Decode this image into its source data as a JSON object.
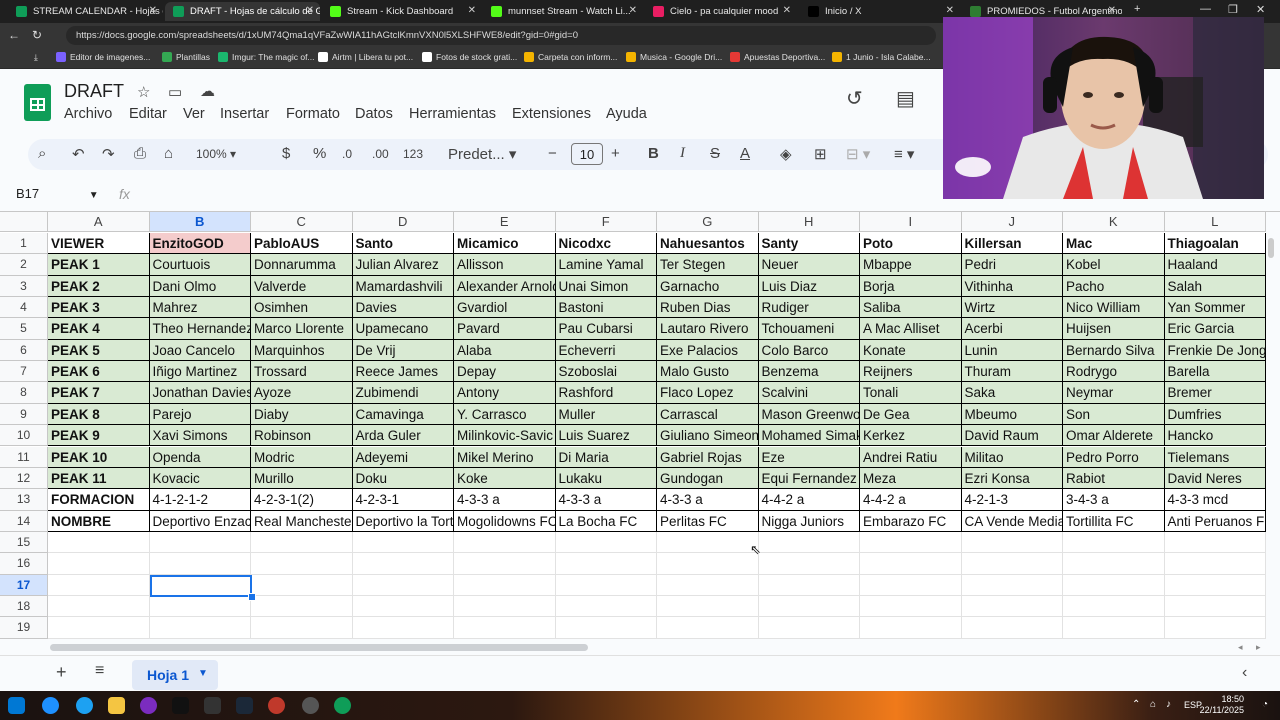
{
  "browser": {
    "tabs": [
      {
        "title": "STREAM CALENDAR - Hojas de c...",
        "color": "#0f9d58"
      },
      {
        "title": "DRAFT - Hojas de cálculo de Goo...",
        "color": "#0f9d58",
        "active": true
      },
      {
        "title": "Stream - Kick Dashboard",
        "color": "#53fc18"
      },
      {
        "title": "munnset Stream - Watch Li...",
        "color": "#53fc18"
      },
      {
        "title": "Cielo - pa cualquier mood",
        "color": "#e91e63"
      },
      {
        "title": "Inicio / X",
        "color": "#000000"
      },
      {
        "title": "PROMIEDOS - Futbol Argentino",
        "color": "#2e7d32"
      }
    ],
    "url": "https://docs.google.com/spreadsheets/d/1xUM74Qma1qVFaZwWIA11hAGtclKmnVXN0l5XLSHFWE8/edit?gid=0#gid=0",
    "bookmarks": [
      "Editor de imagenes...",
      "Plantillas",
      "Imgur: The magic of...",
      "Airtm | Libera tu pot...",
      "Fotos de stock grati...",
      "Carpeta con inform...",
      "Musica - Google Dri...",
      "Apuestas Deportiva...",
      "1 Junio - Isla Calabe..."
    ]
  },
  "sheets": {
    "title": "DRAFT",
    "menus": [
      "Archivo",
      "Editar",
      "Ver",
      "Insertar",
      "Formato",
      "Datos",
      "Herramientas",
      "Extensiones",
      "Ayuda"
    ],
    "toolbar": {
      "zoom": "100%",
      "currency": "$",
      "percent": "%",
      "dec_less": ".0",
      "dec_more": ".00",
      "number_format": "123",
      "font": "Predet...",
      "font_size": "10"
    },
    "name_box": "B17",
    "fx": "fx",
    "columns": [
      "A",
      "B",
      "C",
      "D",
      "E",
      "F",
      "G",
      "H",
      "I",
      "J",
      "K",
      "L"
    ],
    "selected_column": "B",
    "selected_row": "17",
    "rows": [
      [
        "VIEWER",
        "EnzitoGOD",
        "PabloAUS",
        "Santo",
        "Micamico",
        "Nicodxc",
        "Nahuesantos",
        "Santy",
        "Poto",
        "Killersan",
        "Mac",
        "Thiagoalan"
      ],
      [
        "PEAK 1",
        "Courtuois",
        "Donnarumma",
        "Julian Alvarez",
        "Allisson",
        "Lamine Yamal",
        "Ter Stegen",
        "Neuer",
        "Mbappe",
        "Pedri",
        "Kobel",
        "Haaland"
      ],
      [
        "PEAK 2",
        "Dani Olmo",
        "Valverde",
        "Mamardashvili",
        "Alexander Arnold",
        "Unai Simon",
        "Garnacho",
        "Luis Diaz",
        "Borja",
        "Vithinha",
        "Pacho",
        "Salah"
      ],
      [
        "PEAK 3",
        "Mahrez",
        "Osimhen",
        "Davies",
        "Gvardiol",
        "Bastoni",
        "Ruben Dias",
        "Rudiger",
        "Saliba",
        "Wirtz",
        "Nico William",
        "Yan Sommer"
      ],
      [
        "PEAK 4",
        "Theo Hernandez",
        "Marco Llorente",
        "Upamecano",
        "Pavard",
        "Pau Cubarsi",
        "Lautaro Rivero",
        "Tchouameni",
        "A Mac Alliset",
        "Acerbi",
        "Huijsen",
        "Eric Garcia"
      ],
      [
        "PEAK 5",
        "Joao Cancelo",
        "Marquinhos",
        "De Vrij",
        "Alaba",
        "Echeverri",
        "Exe Palacios",
        "Colo Barco",
        "Konate",
        "Lunin",
        "Bernardo Silva",
        "Frenkie De Jong"
      ],
      [
        "PEAK 6",
        "Iñigo Martinez",
        "Trossard",
        "Reece James",
        "Depay",
        "Szoboslai",
        "Malo Gusto",
        "Benzema",
        "Reijners",
        "Thuram",
        "Rodrygo",
        "Barella"
      ],
      [
        "PEAK 7",
        "Jonathan Davies",
        "Ayoze",
        "Zubimendi",
        "Antony",
        "Rashford",
        "Flaco Lopez",
        "Scalvini",
        "Tonali",
        "Saka",
        "Neymar",
        "Bremer"
      ],
      [
        "PEAK 8",
        "Parejo",
        "Diaby",
        "Camavinga",
        "Y. Carrasco",
        "Muller",
        "Carrascal",
        "Mason Greenwood",
        "De Gea",
        "Mbeumo",
        "Son",
        "Dumfries"
      ],
      [
        "PEAK 9",
        "Xavi Simons",
        "Robinson",
        "Arda Guler",
        "Milinkovic-Savic",
        "Luis Suarez",
        "Giuliano Simeone",
        "Mohamed Simakan",
        "Kerkez",
        "David Raum",
        "Omar Alderete",
        "Hancko"
      ],
      [
        "PEAK 10",
        "Openda",
        "Modric",
        "Adeyemi",
        "Mikel Merino",
        "Di Maria",
        "Gabriel Rojas",
        "Eze",
        "Andrei Ratiu",
        "Militao",
        "Pedro Porro",
        "Tielemans"
      ],
      [
        "PEAK 11",
        "Kovacic",
        "Murillo",
        "Doku",
        "Koke",
        "Lukaku",
        "Gundogan",
        "Equi Fernandez",
        "Meza",
        "Ezri Konsa",
        "Rabiot",
        "David Neres"
      ],
      [
        "FORMACION",
        "4-1-2-1-2",
        "4-2-3-1(2)",
        "4-2-3-1",
        "4-3-3 a",
        "4-3-3 a",
        "4-3-3 a",
        "4-4-2 a",
        "4-4-2 a",
        "4-2-1-3",
        "3-4-3 a",
        "4-3-3 mcd"
      ],
      [
        "NOMBRE",
        "Deportivo Enzacio",
        "Real Manchester",
        "Deportivo la Torta",
        "Mogolidowns FC",
        "La Bocha FC",
        "Perlitas FC",
        "Nigga Juniors",
        "Embarazo FC",
        "CA Vende Media",
        "Tortillita FC",
        "Anti Peruanos FC"
      ]
    ],
    "row_numbers": [
      "1",
      "2",
      "3",
      "4",
      "5",
      "6",
      "7",
      "8",
      "9",
      "10",
      "11",
      "12",
      "13",
      "14",
      "15",
      "16",
      "17",
      "18",
      "19"
    ],
    "sheet_tab": "Hoja 1",
    "colors": {
      "green": "#d9ead3",
      "pink": "#f4cccc",
      "accent": "#1a73e8"
    }
  },
  "taskbar": {
    "time": "18:50",
    "date": "22/11/2025",
    "lang": "ESP"
  }
}
